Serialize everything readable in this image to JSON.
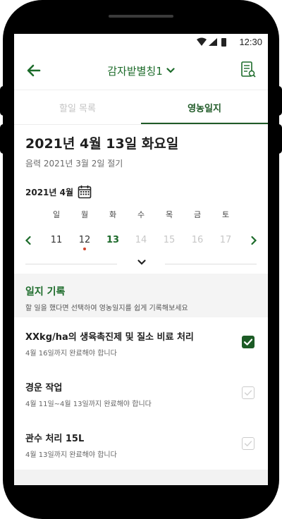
{
  "status_bar": {
    "time": "12:30",
    "wifi_icon": "wifi-icon",
    "signal_icon": "signal-icon",
    "battery_icon": "battery-icon"
  },
  "app_bar": {
    "back_icon": "arrow-left-icon",
    "farm_name": "감자밭별칭1",
    "dropdown_icon": "chevron-down-icon",
    "journal_icon": "farm-journal-icon",
    "accent_color": "#1c6b2a"
  },
  "tabs": [
    {
      "label": "할일 목록",
      "active": false
    },
    {
      "label": "영농일지",
      "active": true
    }
  ],
  "date_header": {
    "title": "2021년 4월 13일 화요일",
    "lunar": "음력 2021년 3월 2일 절기"
  },
  "calendar": {
    "month_label": "2021년 4월",
    "calendar_icon": "calendar-icon",
    "weekdays": [
      "일",
      "월",
      "화",
      "수",
      "목",
      "금",
      "토"
    ],
    "days": [
      {
        "num": "11",
        "state": "past"
      },
      {
        "num": "12",
        "state": "past",
        "has_event": true
      },
      {
        "num": "13",
        "state": "today"
      },
      {
        "num": "14",
        "state": "future"
      },
      {
        "num": "15",
        "state": "future"
      },
      {
        "num": "16",
        "state": "future"
      },
      {
        "num": "17",
        "state": "future"
      }
    ],
    "event_dot_color": "#d0442c"
  },
  "journal": {
    "title": "일지 기록",
    "description": "할 일을 했다면 선택하여 영농일지를 쉽게 기록해보세요"
  },
  "tasks": [
    {
      "title": "XXkg/ha의 생육촉진제 및 질소 비료 처리",
      "due": "4월 16일까지 완료해야 합니다",
      "checked": true
    },
    {
      "title": "경운 작업",
      "due": "4월 11일~4월 13일까지 완료해야 합니다",
      "checked": false
    },
    {
      "title": "관수 처리 15L",
      "due": "4월 13일까지 완료해야 합니다",
      "checked": false
    }
  ]
}
